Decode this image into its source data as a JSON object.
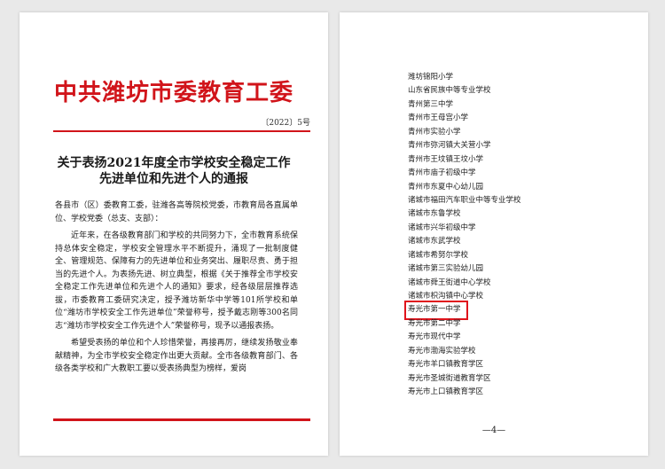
{
  "left_page": {
    "org_header": "中共潍坊市委教育工委",
    "doc_number": "〔2022〕5号",
    "title_lines": [
      "关于表扬2021年度全市学校安全稳定工作",
      "先进单位和先进个人的通报"
    ],
    "paragraphs": [
      "各县市（区）委教育工委，驻潍各高等院校党委，市教育局各直属单位、学校党委（总支、支部）：",
      "近年来，在各级教育部门和学校的共同努力下，全市教育系统保持总体安全稳定，学校安全管理水平不断提升，涌现了一批制度健全、管理规范、保障有力的先进单位和业务突出、履职尽责、勇于担当的先进个人。为表扬先进、树立典型，根据《关于推荐全市学校安全稳定工作先进单位和先进个人的通知》要求，经各级层层推荐选拔，市委教育工委研究决定，授予潍坊新华中学等101所学校和单位“潍坊市学校安全工作先进单位”荣誉称号，授予戴志刚等300名同志“潍坊市学校安全工作先进个人”荣誉称号，现予以通报表扬。",
      "希望受表扬的单位和个人珍惜荣誉，再接再厉，继续发扬敬业奉献精神，为全市学校安全稳定作出更大贡献。全市各级教育部门、各级各类学校和广大教职工要以受表扬典型为榜样，爱岗"
    ]
  },
  "right_page": {
    "schools": [
      "潍坊锦阳小学",
      "山东省民族中等专业学校",
      "青州第三中学",
      "青州市王母宫小学",
      "青州市实验小学",
      "青州市弥河镇大关营小学",
      "青州市王坟镇王坟小学",
      "青州市庙子初级中学",
      "青州市东夏中心幼儿园",
      "诸城市福田汽车职业中等专业学校",
      "诸城市东鲁学校",
      "诸城市兴华初级中学",
      "诸城市东武学校",
      "诸城市希努尔学校",
      "诸城市第三实验幼儿园",
      "诸城市舜王街道中心学校",
      "诸城市枳沟镇中心学校",
      "寿光市第一中学",
      "寿光市第二中学",
      "寿光市现代中学",
      "寿光市渤海实验学校",
      "寿光市羊口镇教育学区",
      "寿光市圣城街道教育学区",
      "寿光市上口镇教育学区"
    ],
    "highlighted_index": 17,
    "highlight_color": "#e0141c",
    "page_number": "—4—"
  },
  "colors": {
    "red_header": "#d1141a",
    "background": "#e9e9e9"
  }
}
